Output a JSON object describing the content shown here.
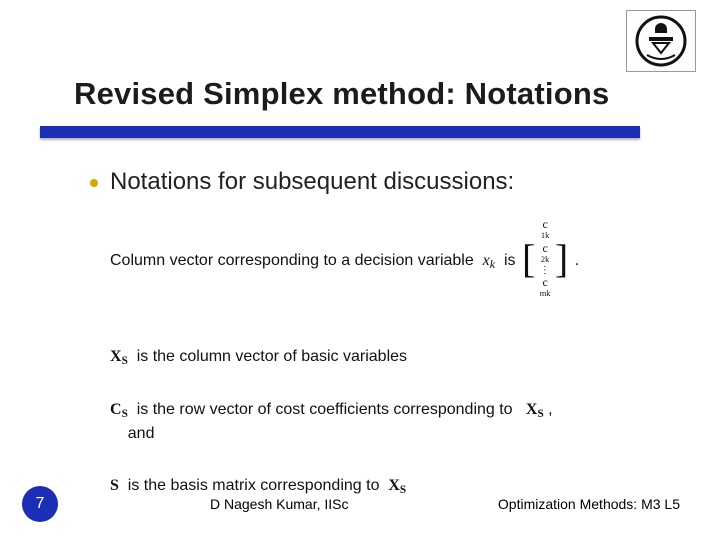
{
  "title": "Revised Simplex method: Notations",
  "subhead": "Notations for subsequent discussions:",
  "items": {
    "col_vector_pre": "Column vector corresponding to a decision variable",
    "col_is": "is",
    "col_period": ".",
    "vec_top": "c",
    "vec_top_sub": "1k",
    "vec_mid": "c",
    "vec_mid_sub": "2k",
    "vec_bot": "c",
    "vec_bot_sub": "mk",
    "xk": "x",
    "xk_sub": "k",
    "xs_line": "is the column vector of basic variables",
    "cs_line1": "is the row vector of cost coefficients corresponding to",
    "cs_line2": "and",
    "s_line": "is the basis matrix corresponding to",
    "sym": {
      "XS": "X",
      "XS_sub": "S",
      "CS": "C",
      "CS_sub": "S",
      "S": "S"
    },
    "comma": ","
  },
  "footer": {
    "page": "7",
    "author": "D Nagesh Kumar, IISc",
    "course": "Optimization Methods: M3 L5"
  }
}
